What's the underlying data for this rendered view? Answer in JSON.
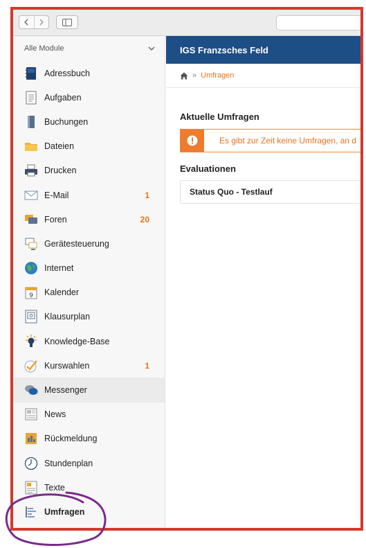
{
  "browser": {
    "back_icon": "chevron-left-icon",
    "forward_icon": "chevron-right-icon",
    "sidebar_toggle_icon": "sidebar-toggle-icon"
  },
  "sidebar": {
    "header_label": "Alle Module",
    "items": [
      {
        "label": "Adressbuch",
        "icon": "address-book-icon",
        "badge": ""
      },
      {
        "label": "Aufgaben",
        "icon": "tasks-icon",
        "badge": ""
      },
      {
        "label": "Buchungen",
        "icon": "bookings-icon",
        "badge": ""
      },
      {
        "label": "Dateien",
        "icon": "folder-icon",
        "badge": ""
      },
      {
        "label": "Drucken",
        "icon": "printer-icon",
        "badge": ""
      },
      {
        "label": "E-Mail",
        "icon": "email-icon",
        "badge": "1"
      },
      {
        "label": "Foren",
        "icon": "forum-icon",
        "badge": "20"
      },
      {
        "label": "Gerätesteuerung",
        "icon": "device-control-icon",
        "badge": ""
      },
      {
        "label": "Internet",
        "icon": "globe-icon",
        "badge": ""
      },
      {
        "label": "Kalender",
        "icon": "calendar-icon",
        "badge": ""
      },
      {
        "label": "Klausurplan",
        "icon": "exam-plan-icon",
        "badge": ""
      },
      {
        "label": "Knowledge-Base",
        "icon": "lightbulb-icon",
        "badge": ""
      },
      {
        "label": "Kurswahlen",
        "icon": "checkmark-icon",
        "badge": "1"
      },
      {
        "label": "Messenger",
        "icon": "chat-bubbles-icon",
        "badge": ""
      },
      {
        "label": "News",
        "icon": "newspaper-icon",
        "badge": ""
      },
      {
        "label": "Rückmeldung",
        "icon": "feedback-icon",
        "badge": ""
      },
      {
        "label": "Stundenplan",
        "icon": "clock-icon",
        "badge": ""
      },
      {
        "label": "Texte",
        "icon": "text-document-icon",
        "badge": ""
      },
      {
        "label": "Umfragen",
        "icon": "survey-bars-icon",
        "badge": ""
      }
    ]
  },
  "main": {
    "school_name": "IGS Franzsches Feld",
    "breadcrumb": {
      "home_icon": "home-icon",
      "separator": "»",
      "current": "Umfragen"
    },
    "current_surveys_title": "Aktuelle Umfragen",
    "alert_text": "Es gibt zur Zeit keine Umfragen, an d",
    "evaluations_title": "Evaluationen",
    "evaluations": [
      "Status Quo - Testlauf"
    ]
  },
  "colors": {
    "brand_blue": "#1d4e86",
    "accent_orange": "#e8731e",
    "annotation_red": "#d6372c",
    "annotation_purple": "#7a2a8a"
  }
}
